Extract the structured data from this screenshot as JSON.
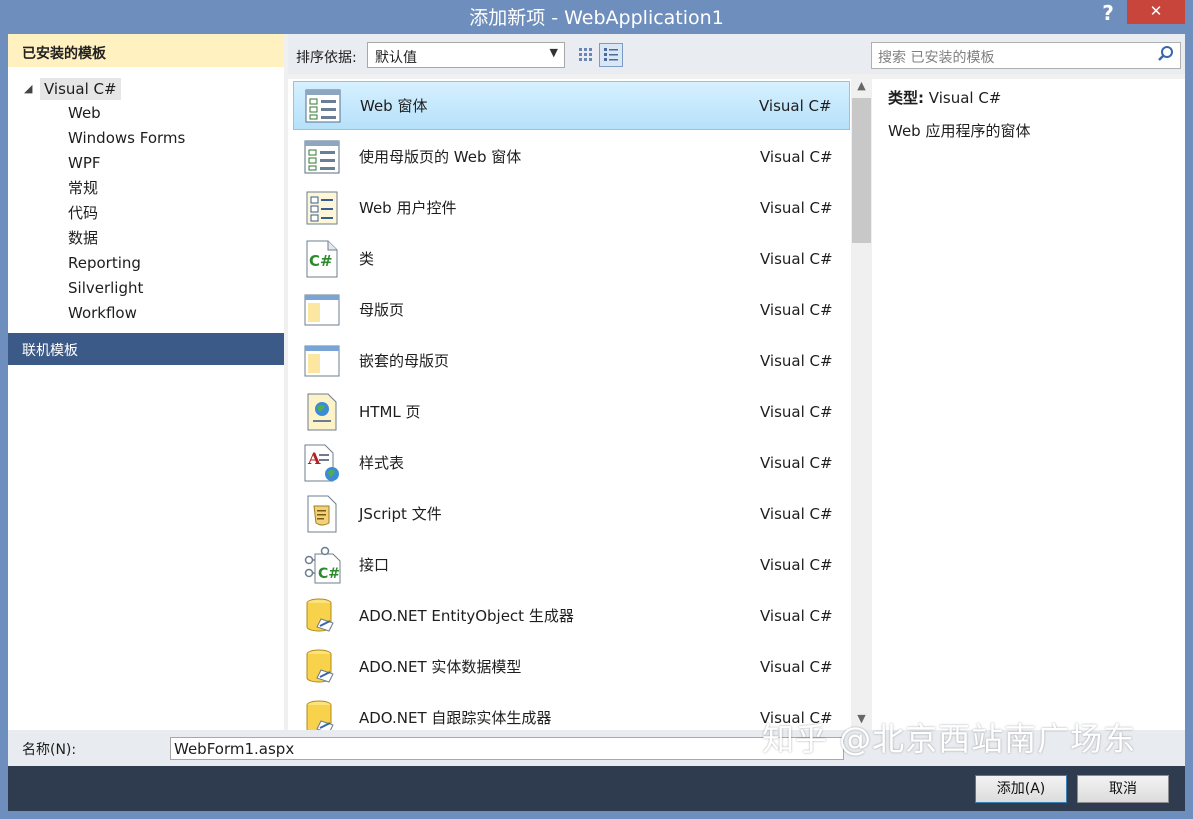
{
  "window": {
    "title": "添加新项 - WebApplication1",
    "help_label": "?",
    "close_label": "✕"
  },
  "sidebar": {
    "header": "已安装的模板",
    "root": {
      "label": "Visual C#",
      "expanded": true
    },
    "items": [
      {
        "label": "Web"
      },
      {
        "label": "Windows Forms"
      },
      {
        "label": "WPF"
      },
      {
        "label": "常规"
      },
      {
        "label": "代码"
      },
      {
        "label": "数据"
      },
      {
        "label": "Reporting"
      },
      {
        "label": "Silverlight"
      },
      {
        "label": "Workflow"
      }
    ],
    "online": "联机模板"
  },
  "toolbar": {
    "sort_label": "排序依据:",
    "sort_value": "默认值",
    "search_placeholder": "搜索 已安装的模板"
  },
  "templates": [
    {
      "name": "Web 窗体",
      "lang": "Visual C#",
      "icon": "webform-icon",
      "selected": true
    },
    {
      "name": "使用母版页的 Web 窗体",
      "lang": "Visual C#",
      "icon": "webform-icon"
    },
    {
      "name": "Web 用户控件",
      "lang": "Visual C#",
      "icon": "user-control-icon"
    },
    {
      "name": "类",
      "lang": "Visual C#",
      "icon": "class-icon"
    },
    {
      "name": "母版页",
      "lang": "Visual C#",
      "icon": "master-page-icon"
    },
    {
      "name": "嵌套的母版页",
      "lang": "Visual C#",
      "icon": "master-page-icon"
    },
    {
      "name": "HTML 页",
      "lang": "Visual C#",
      "icon": "html-page-icon"
    },
    {
      "name": "样式表",
      "lang": "Visual C#",
      "icon": "stylesheet-icon"
    },
    {
      "name": "JScript 文件",
      "lang": "Visual C#",
      "icon": "jscript-file-icon"
    },
    {
      "name": "接口",
      "lang": "Visual C#",
      "icon": "interface-icon"
    },
    {
      "name": "ADO.NET EntityObject 生成器",
      "lang": "Visual C#",
      "icon": "database-icon"
    },
    {
      "name": "ADO.NET 实体数据模型",
      "lang": "Visual C#",
      "icon": "database-icon"
    },
    {
      "name": "ADO.NET 自跟踪实体生成器",
      "lang": "Visual C#",
      "icon": "database-icon"
    }
  ],
  "details": {
    "type_label": "类型:",
    "type_value": "Visual C#",
    "description": "Web 应用程序的窗体"
  },
  "bottom": {
    "name_label": "名称(N):",
    "name_value": "WebForm1.aspx",
    "add_button": "添加(A)",
    "cancel_button": "取消"
  },
  "watermark": "知乎 @北京西站南广场东",
  "colors": {
    "title_bar": "#6e8fbd",
    "selection": "#b6e1fa",
    "sidebar_header": "#fff2c0",
    "online_band": "#3c5a88",
    "footer": "#2f3c50"
  }
}
